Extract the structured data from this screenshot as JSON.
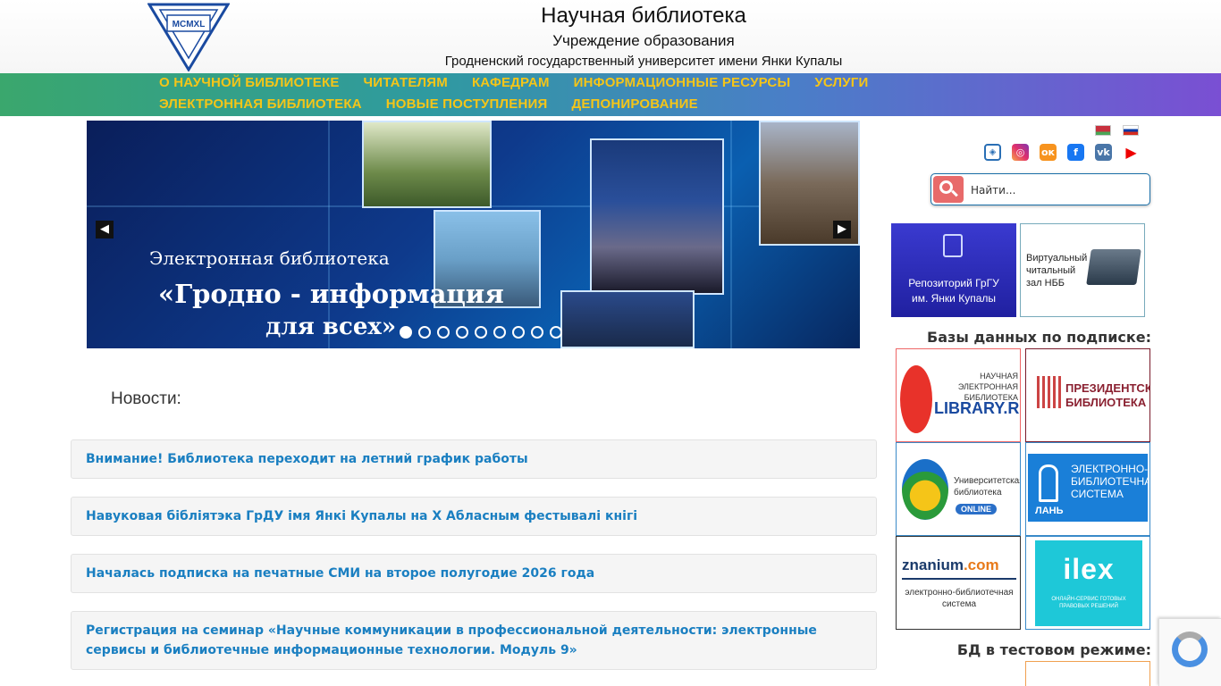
{
  "header": {
    "logo_text": "MCMXL",
    "title": "Научная библиотека",
    "subtitle1": "Учреждение образования",
    "subtitle2": "Гродненский государственный университет имени Янки Купалы"
  },
  "nav": {
    "row1": [
      "О НАУЧНОЙ БИБЛИОТЕКЕ",
      "ЧИТАТЕЛЯМ",
      "КАФЕДРАМ",
      "ИНФОРМАЦИОННЫЕ РЕСУРСЫ",
      "УСЛУГИ"
    ],
    "row2": [
      "ЭЛЕКТРОННАЯ БИБЛИОТЕКА",
      "НОВЫЕ ПОСТУПЛЕНИЯ",
      "ДЕПОНИРОВАНИЕ"
    ]
  },
  "slider": {
    "line1": "Электронная библиотека",
    "line2": "«Гродно - информация",
    "line3": "для всех»",
    "prev_icon": "chevron-left-icon",
    "next_icon": "chevron-right-icon",
    "prev_glyph": "◀",
    "next_glyph": "▶",
    "slide_count": 9,
    "active_index": 0
  },
  "news": {
    "heading": "Новости:",
    "items": [
      "Внимание! Библиотека переходит на летний график работы",
      "Навуковая бібліятэка ГрДУ імя Янкі Купалы на X Абласным фестывалі кнігі",
      "Началась подписка на печатные СМИ на второе полугодие 2026 года",
      "Регистрация на семинар «Научные коммуникации в профессиональной деятельности: электронные сервисы и библиотечные информационные технологии. Модуль 9»"
    ]
  },
  "language": {
    "icons": [
      "flag-by-icon",
      "flag-ru-icon"
    ]
  },
  "social": {
    "icons": [
      "education-icon",
      "instagram-icon",
      "odnoklassniki-icon",
      "facebook-icon",
      "vk-icon",
      "youtube-icon"
    ],
    "glyphs": {
      "education": "◈",
      "instagram": "◎",
      "odnoklassniki": "ок",
      "facebook": "f",
      "vk": "vk",
      "youtube": "▶"
    }
  },
  "search": {
    "placeholder": "Найти...",
    "icon": "search-icon"
  },
  "banners": {
    "repository": "Репозиторий ГрГУ им. Янки Купалы",
    "virtual_hall": "Виртуальный читальный зал НББ"
  },
  "subscription": {
    "label": "Базы данных по подписке:",
    "elibrary_line1": "НАУЧНАЯ ЭЛЕКТРОННАЯ БИБЛИОТЕКА",
    "elibrary_line2": "LIBRARY.RU",
    "presidential": "ПРЕЗИДЕНТСКАЯ БИБЛИОТЕКА",
    "university_online_text": "Университетская библиотека",
    "university_online_badge": "ONLINE",
    "lan_name": "ЛАНЬ",
    "lan_text": "ЭЛЕКТРОННО-БИБЛИОТЕЧНАЯ СИСТЕМА",
    "znanium_logo": "znanium",
    "znanium_suffix": ".com",
    "znanium_text": "электронно-библиотечная система",
    "ilex_logo": "ilex",
    "ilex_text": "ОНЛАЙН-СЕРВИС ГОТОВЫХ ПРАВОВЫХ РЕШЕНИЙ"
  },
  "test_mode": {
    "label": "БД в тестовом режиме:"
  },
  "colors": {
    "nav_text": "#f5c518",
    "link": "#1a7fc1"
  }
}
